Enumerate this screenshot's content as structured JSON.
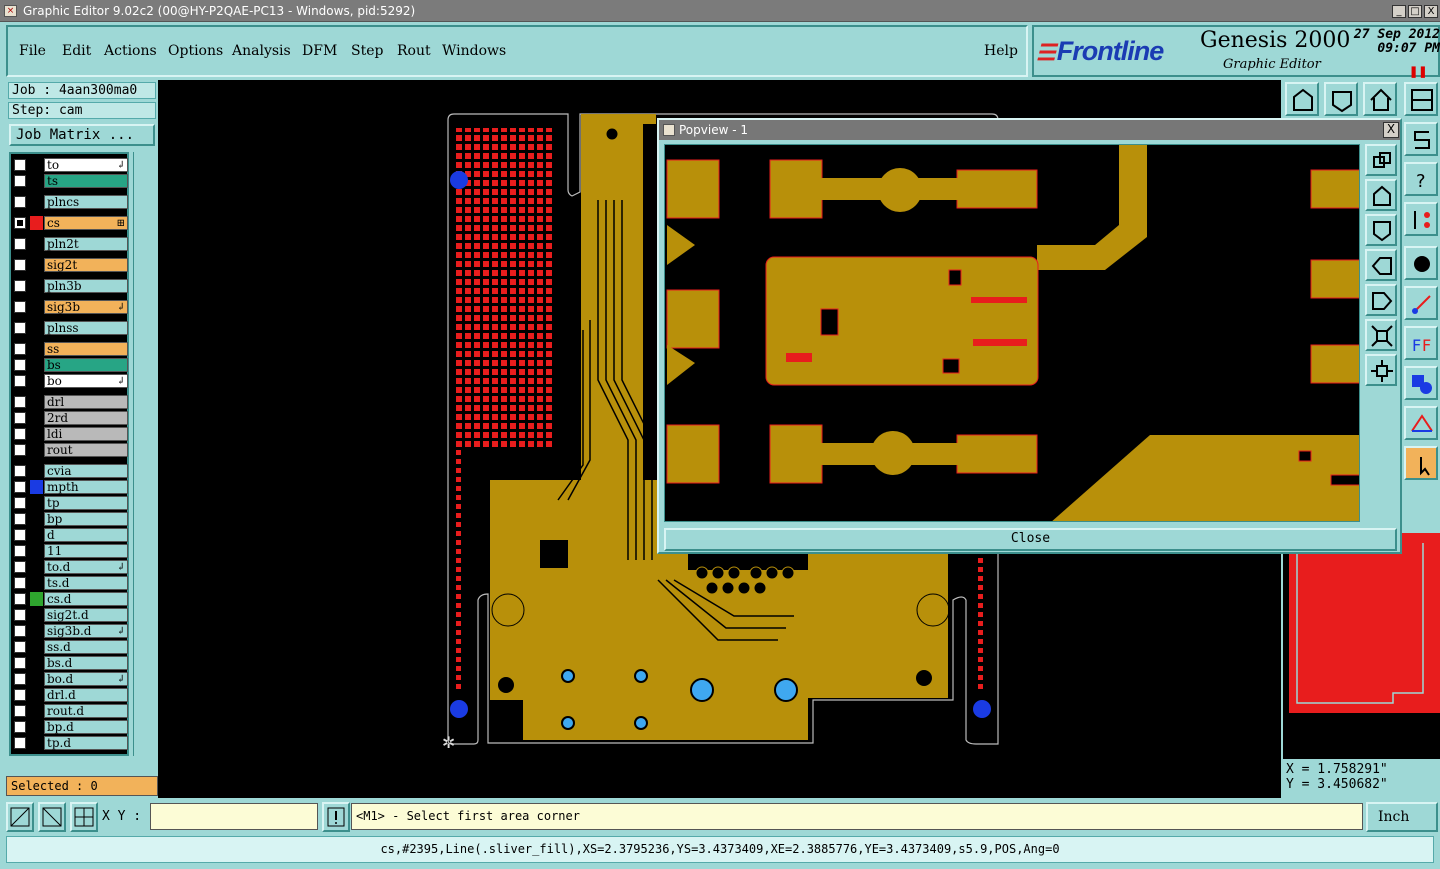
{
  "window": {
    "title": "Graphic Editor 9.02c2 (00@HY-P2QAE-PC13 - Windows, pid:5292)",
    "buttons": [
      "_",
      "□",
      "X"
    ]
  },
  "menu": {
    "items": [
      "File",
      "Edit",
      "Actions",
      "Options",
      "Analysis",
      "DFM",
      "Step",
      "Rout",
      "Windows"
    ],
    "help": "Help"
  },
  "brand": {
    "logo": "Frontline",
    "product": "Genesis 2000",
    "subtitle": "Graphic Editor",
    "date": "27 Sep 2012",
    "time": "09:07 PM",
    "pause_glyph": "❚❚"
  },
  "job": {
    "job_label": "Job : 4aan300ma0",
    "step_label": "Step: cam",
    "job_matrix": "Job Matrix ..."
  },
  "layers": [
    {
      "name": "to",
      "color": "#ffffff",
      "marker": "",
      "flag": "↲",
      "checked": false
    },
    {
      "name": "ts",
      "color": "#27a585",
      "marker": "",
      "flag": "",
      "checked": false
    },
    {
      "name": "plncs",
      "color": "#9ed8d6",
      "marker": "",
      "flag": "",
      "checked": false,
      "gap": true
    },
    {
      "name": "cs",
      "color": "#f2b25a",
      "marker": "#e81d1d",
      "flag": "⊞",
      "checked": true,
      "gap": true
    },
    {
      "name": "pln2t",
      "color": "#9ed8d6",
      "marker": "",
      "flag": "",
      "checked": false,
      "gap": true
    },
    {
      "name": "sig2t",
      "color": "#f2b25a",
      "marker": "",
      "flag": "",
      "checked": false,
      "gap": true
    },
    {
      "name": "pln3b",
      "color": "#9ed8d6",
      "marker": "",
      "flag": "",
      "checked": false,
      "gap": true
    },
    {
      "name": "sig3b",
      "color": "#f2b25a",
      "marker": "",
      "flag": "↲",
      "checked": false,
      "gap": true
    },
    {
      "name": "plnss",
      "color": "#9ed8d6",
      "marker": "",
      "flag": "",
      "checked": false,
      "gap": true
    },
    {
      "name": "ss",
      "color": "#f2b25a",
      "marker": "",
      "flag": "",
      "checked": false,
      "gap": true
    },
    {
      "name": "bs",
      "color": "#27a585",
      "marker": "",
      "flag": "",
      "checked": false
    },
    {
      "name": "bo",
      "color": "#ffffff",
      "marker": "",
      "flag": "↲",
      "checked": false
    },
    {
      "name": "drl",
      "color": "#b9b9b9",
      "marker": "",
      "flag": "",
      "checked": false,
      "gap": true
    },
    {
      "name": "2rd",
      "color": "#b9b9b9",
      "marker": "",
      "flag": "",
      "checked": false
    },
    {
      "name": "ldi",
      "color": "#b9b9b9",
      "marker": "",
      "flag": "",
      "checked": false
    },
    {
      "name": "rout",
      "color": "#b9b9b9",
      "marker": "",
      "flag": "",
      "checked": false
    },
    {
      "name": "cvia",
      "color": "#9ed8d6",
      "marker": "",
      "flag": "",
      "checked": false,
      "gap": true
    },
    {
      "name": "mpth",
      "color": "#9ed8d6",
      "marker": "#1a3be3",
      "flag": "",
      "checked": false
    },
    {
      "name": "tp",
      "color": "#9ed8d6",
      "marker": "",
      "flag": "",
      "checked": false
    },
    {
      "name": "bp",
      "color": "#9ed8d6",
      "marker": "",
      "flag": "",
      "checked": false
    },
    {
      "name": "d",
      "color": "#9ed8d6",
      "marker": "",
      "flag": "",
      "checked": false
    },
    {
      "name": "11",
      "color": "#9ed8d6",
      "marker": "",
      "flag": "",
      "checked": false
    },
    {
      "name": "to.d",
      "color": "#9ed8d6",
      "marker": "",
      "flag": "↲",
      "checked": false
    },
    {
      "name": "ts.d",
      "color": "#9ed8d6",
      "marker": "",
      "flag": "",
      "checked": false
    },
    {
      "name": "cs.d",
      "color": "#9ed8d6",
      "marker": "#2ea52e",
      "flag": "",
      "checked": false
    },
    {
      "name": "sig2t.d",
      "color": "#9ed8d6",
      "marker": "",
      "flag": "",
      "checked": false
    },
    {
      "name": "sig3b.d",
      "color": "#9ed8d6",
      "marker": "",
      "flag": "↲",
      "checked": false
    },
    {
      "name": "ss.d",
      "color": "#9ed8d6",
      "marker": "",
      "flag": "",
      "checked": false
    },
    {
      "name": "bs.d",
      "color": "#9ed8d6",
      "marker": "",
      "flag": "",
      "checked": false
    },
    {
      "name": "bo.d",
      "color": "#9ed8d6",
      "marker": "",
      "flag": "↲",
      "checked": false
    },
    {
      "name": "drl.d",
      "color": "#9ed8d6",
      "marker": "",
      "flag": "",
      "checked": false
    },
    {
      "name": "rout.d",
      "color": "#9ed8d6",
      "marker": "",
      "flag": "",
      "checked": false
    },
    {
      "name": "bp.d",
      "color": "#9ed8d6",
      "marker": "",
      "flag": "",
      "checked": false
    },
    {
      "name": "tp.d",
      "color": "#9ed8d6",
      "marker": "",
      "flag": "",
      "checked": false
    }
  ],
  "selected_label": "Selected : 0",
  "colors": {
    "copper": "#b8900a",
    "accent_red": "#e81d1d",
    "via_blue": "#1a3be3",
    "ui_teal": "#9ed8d6"
  },
  "popview": {
    "title": "Popview - 1",
    "close_label": "Close",
    "close_x": "X"
  },
  "coords": {
    "x": "X = 1.758291\"",
    "y": "Y = 3.450682\""
  },
  "bottom": {
    "xy_label": "X Y :",
    "xy_value": "",
    "prompt": "<M1> - Select first area corner",
    "unit": "Inch",
    "status": "cs,#2395,Line(.sliver_fill),XS=2.3795236,YS=3.4373409,XE=2.3885776,YE=3.4373409,s5.9,POS,Ang=0"
  },
  "toolbar_icons": [
    "home-up-icon",
    "home-down-icon",
    "home-icon",
    "window-layout-icon",
    "snap-s-icon",
    "help-icon",
    "tree-icon",
    "dot-icon",
    "measure-icon",
    "ff-icon",
    "shapes-icon",
    "arc-icon",
    "select-cursor-icon"
  ],
  "popview_tool_icons": [
    "zoom-home-icon",
    "pan-up-icon",
    "pan-down-icon",
    "pan-left-icon",
    "pan-right-icon",
    "fit-icon",
    "center-icon"
  ]
}
